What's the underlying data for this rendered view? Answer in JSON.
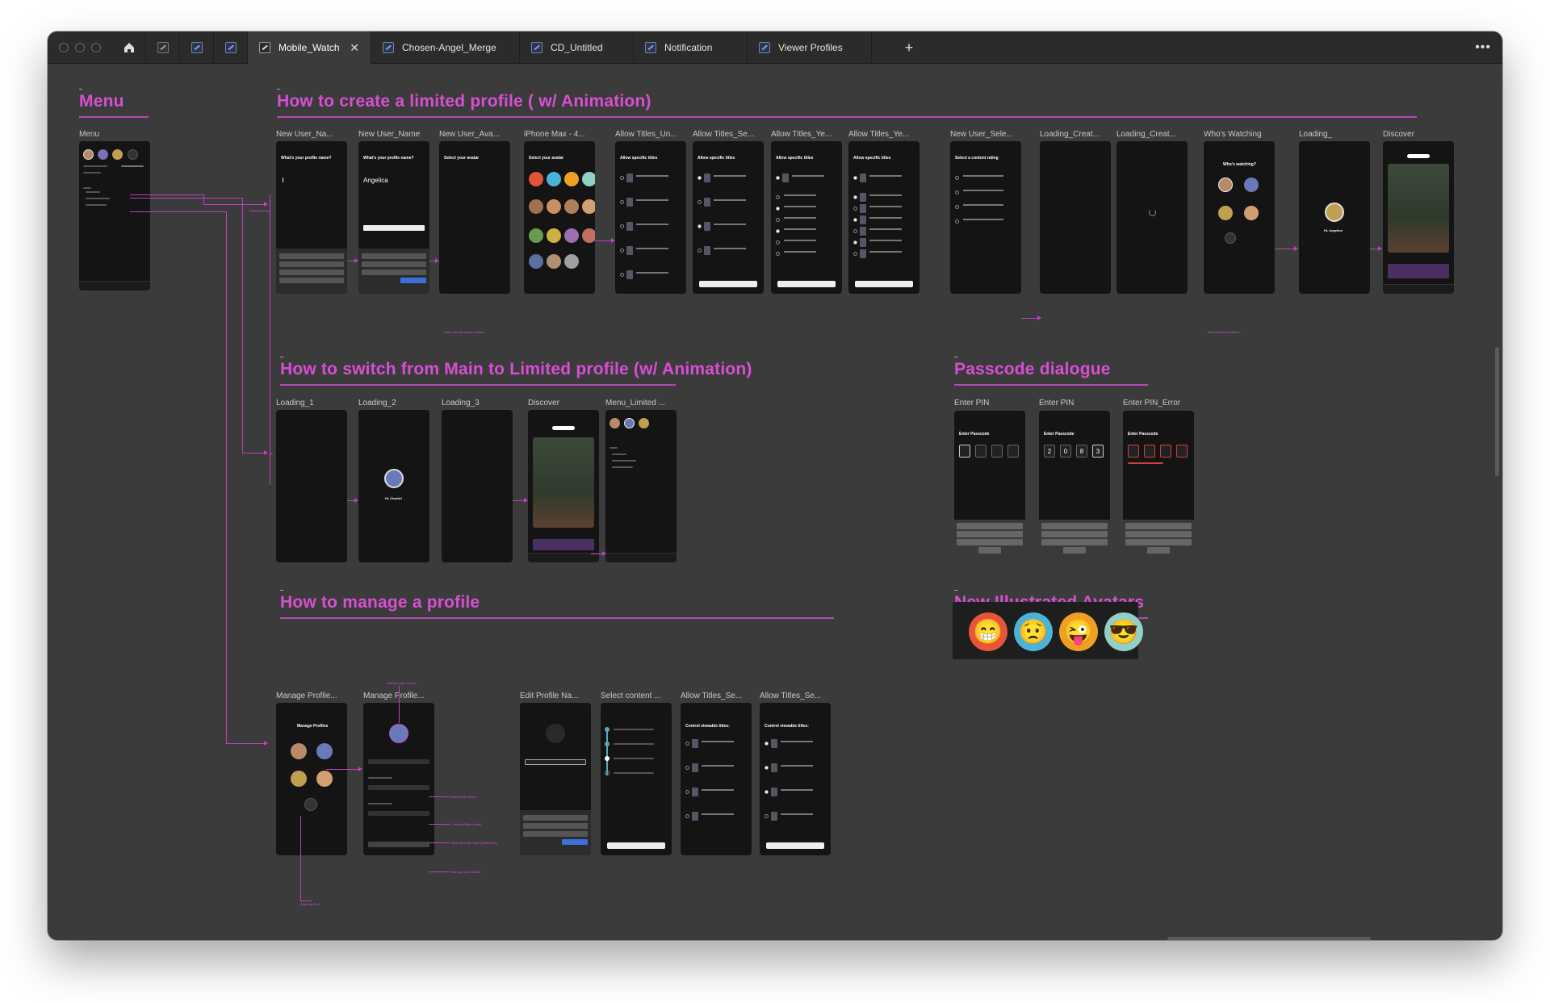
{
  "app": {
    "brand_color": "#d84fd3",
    "canvas_color": "#3b3b3b"
  },
  "tabs": [
    {
      "label": "Mobile_Watch",
      "active": true
    },
    {
      "label": "Chosen-Angel_Merge"
    },
    {
      "label": "CD_Untitled"
    },
    {
      "label": "Notification"
    },
    {
      "label": "Viewer Profiles"
    }
  ],
  "sections": {
    "menu": {
      "title": "Menu",
      "frames": [
        "Menu"
      ]
    },
    "create": {
      "title": "How to create a limited profile ( w/ Animation)",
      "frames": [
        "New User_Na...",
        "New User_Name",
        "New User_Ava...",
        "iPhone Max - 4...",
        "Allow Titles_Un...",
        "Allow Titles_Se...",
        "Allow Titles_Ye...",
        "Allow Titles_Ye...",
        "New User_Sele...",
        "Loading_Creat...",
        "Loading_Creat...",
        "Who's Watching",
        "Loading_",
        "Discover"
      ],
      "notes": [
        "Last Load the Avatar section",
        "New profile animation?"
      ],
      "texts": {
        "profile_q": "What's your profile name?",
        "typed_name": "Angelica",
        "select_avatar": "Select your avatar",
        "allow": "Allow specific titles",
        "rating": "Select a content rating",
        "who": "Who's watching?",
        "hi": "Hi, Angelica"
      }
    },
    "switch": {
      "title": "How to switch from Main to Limited profile (w/ Animation)",
      "frames": [
        "Loading_1",
        "Loading_2",
        "Loading_3",
        "Discover",
        "Menu_Limited ..."
      ],
      "texts": {
        "hi": "Hi, Charlie!"
      }
    },
    "passcode": {
      "title": "Passcode dialogue",
      "frames": [
        "Enter PIN",
        "Enter PIN",
        "Enter PIN_Error"
      ],
      "texts": {
        "heading": "Enter Passcode",
        "digits": [
          "2",
          "0",
          "8",
          "3"
        ]
      }
    },
    "manage": {
      "title": "How to manage a profile",
      "frames": [
        "Manage Profile...",
        "Manage Profile...",
        "Edit Profile Na...",
        "Select content ...",
        "Allow Titles_Se...",
        "Allow Titles_Se..."
      ],
      "notes": [
        "Select Avatar Screen",
        "Edit profile name",
        "Content Rating slider",
        "Allow Specific Titles (default list)",
        "Are you sure modal?",
        "Add new Prof"
      ],
      "texts": {
        "manage": "Manage Profiles",
        "control": "Control viewable titles:"
      }
    },
    "avatars": {
      "title": "New Illustrated Avatars",
      "items": [
        {
          "icon": "grin-face-icon",
          "color": "#e8553a"
        },
        {
          "icon": "worried-face-icon",
          "color": "#4ab3d8"
        },
        {
          "icon": "tongue-face-icon",
          "color": "#f0a020"
        },
        {
          "icon": "cool-face-icon",
          "color": "#8fd0c8"
        }
      ]
    }
  }
}
